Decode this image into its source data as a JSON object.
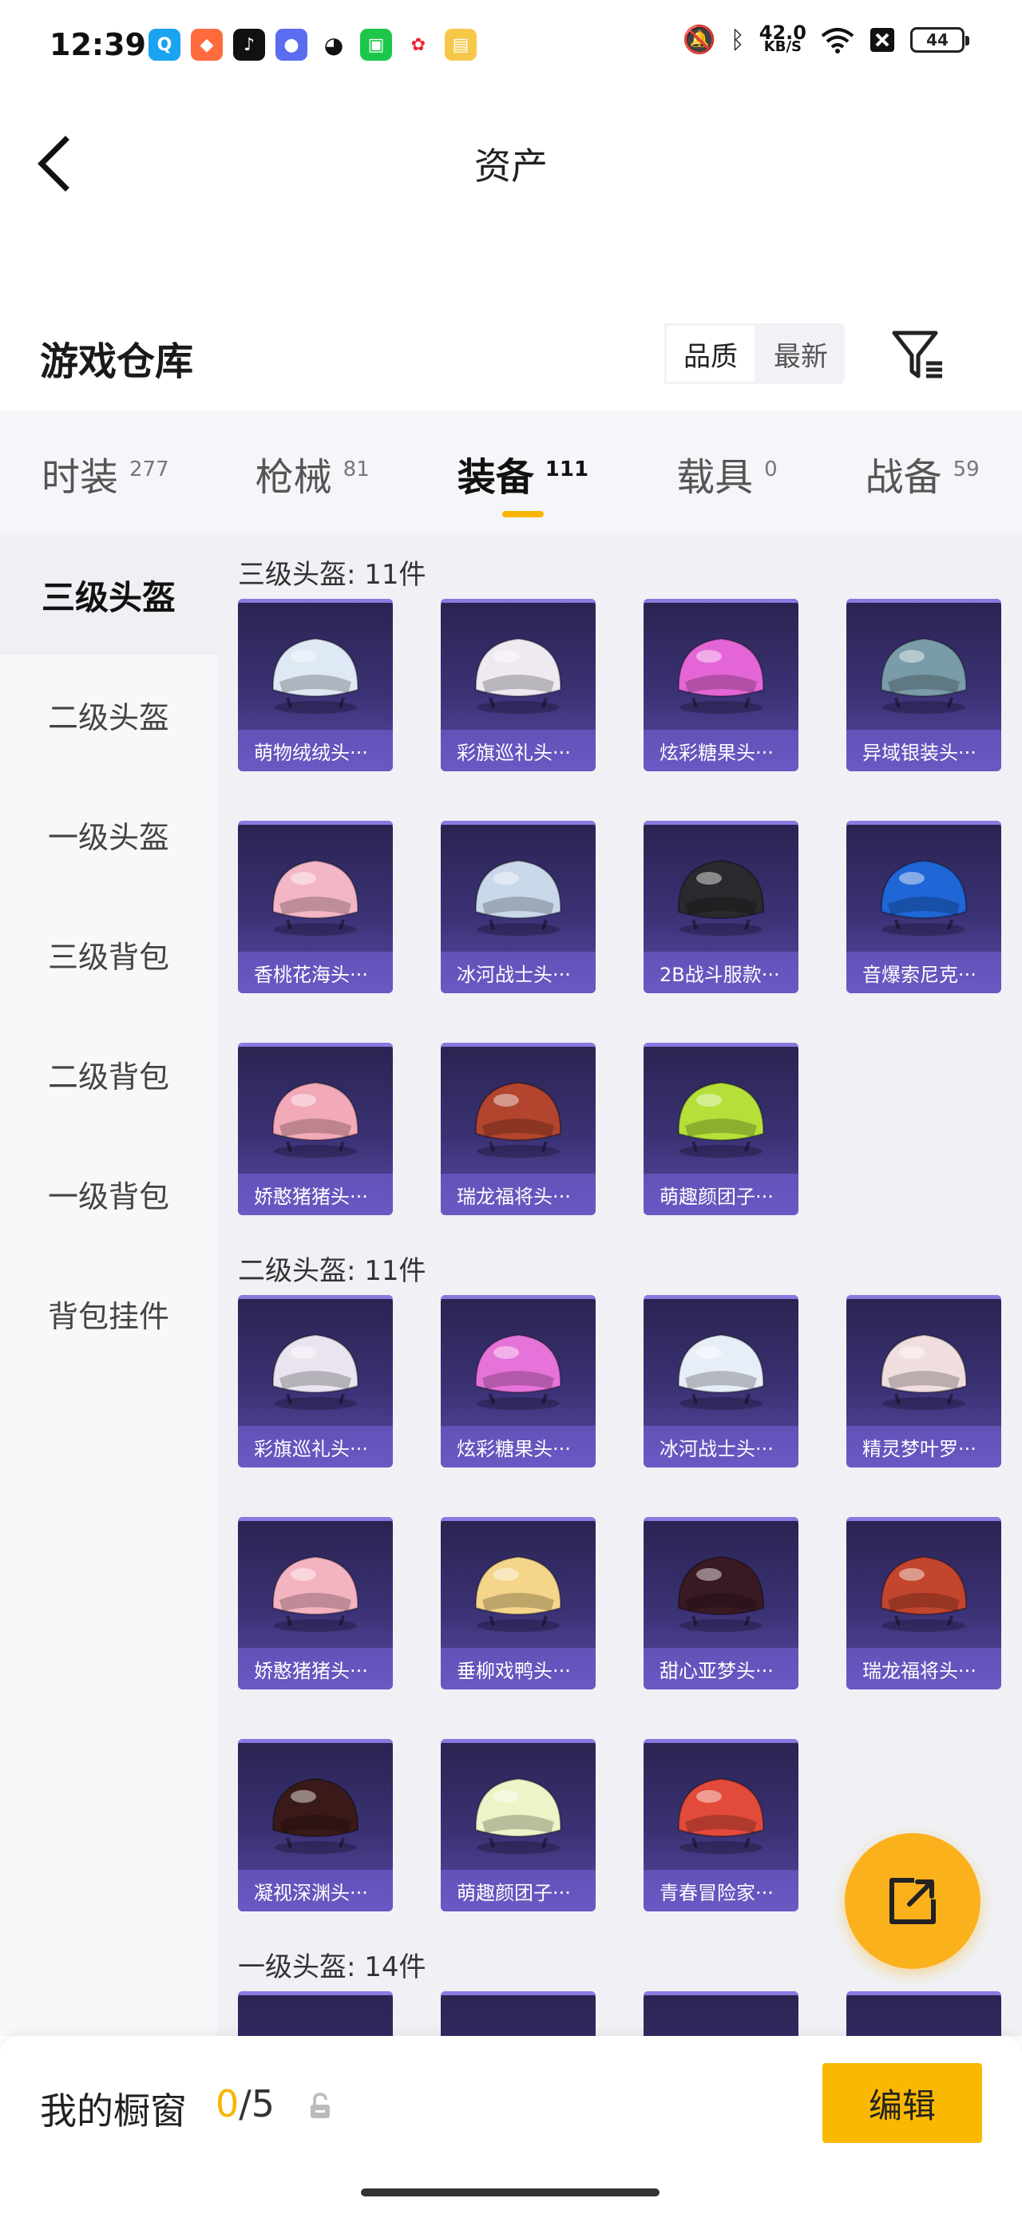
{
  "status_bar": {
    "time": "12:39",
    "speed_value": "42.0",
    "speed_unit": "KB/S",
    "battery": "44",
    "apps": [
      "qq-icon",
      "game-icon",
      "tiktok-icon",
      "app-icon",
      "wechat-icon",
      "app-icon",
      "app-icon",
      "notes-icon"
    ]
  },
  "nav": {
    "title": "资产"
  },
  "section": {
    "title": "游戏仓库",
    "sort_options": [
      "品质",
      "最新"
    ],
    "sort_active": "品质"
  },
  "tabs": [
    {
      "label": "时装",
      "count": "277"
    },
    {
      "label": "枪械",
      "count": "81"
    },
    {
      "label": "装备",
      "count": "111"
    },
    {
      "label": "载具",
      "count": "0"
    },
    {
      "label": "战备",
      "count": "59"
    }
  ],
  "active_tab": "装备",
  "sidebar": [
    {
      "label": "三级头盔"
    },
    {
      "label": "二级头盔"
    },
    {
      "label": "一级头盔"
    },
    {
      "label": "三级背包"
    },
    {
      "label": "二级背包"
    },
    {
      "label": "一级背包"
    },
    {
      "label": "背包挂件"
    }
  ],
  "active_sidebar": "三级头盔",
  "groups": [
    {
      "title": "三级头盔: 11件",
      "items": [
        {
          "name": "萌物绒绒头···",
          "color": "#dfe8f5"
        },
        {
          "name": "彩旗巡礼头···",
          "color": "#efe9f2"
        },
        {
          "name": "炫彩糖果头···",
          "color": "#e466d6"
        },
        {
          "name": "异域银装头···",
          "color": "#7a9ba8"
        },
        {
          "name": "香桃花海头···",
          "color": "#f3b6c6"
        },
        {
          "name": "冰河战士头···",
          "color": "#c9d9ea"
        },
        {
          "name": "2B战斗服款···",
          "color": "#2a2a2e"
        },
        {
          "name": "音爆索尼克···",
          "color": "#1f66d6"
        },
        {
          "name": "娇憨猪猪头···",
          "color": "#f2a9b8"
        },
        {
          "name": "瑞龙福将头···",
          "color": "#b3442e"
        },
        {
          "name": "萌趣颜团子···",
          "color": "#b5e03a"
        }
      ]
    },
    {
      "title": "二级头盔: 11件",
      "items": [
        {
          "name": "彩旗巡礼头···",
          "color": "#e9e4ef"
        },
        {
          "name": "炫彩糖果头···",
          "color": "#e673d9"
        },
        {
          "name": "冰河战士头···",
          "color": "#e7eef8"
        },
        {
          "name": "精灵梦叶罗···",
          "color": "#f0dede"
        },
        {
          "name": "娇憨猪猪头···",
          "color": "#f4b3c0"
        },
        {
          "name": "垂柳戏鸭头···",
          "color": "#f4d58a"
        },
        {
          "name": "甜心亚梦头···",
          "color": "#3a1a22"
        },
        {
          "name": "瑞龙福将头···",
          "color": "#c2452e"
        },
        {
          "name": "凝视深渊头···",
          "color": "#3a1a18"
        },
        {
          "name": "萌趣颜团子···",
          "color": "#eef4c8"
        },
        {
          "name": "青春冒险家···",
          "color": "#e24a3a"
        }
      ]
    },
    {
      "title": "一级头盔: 14件",
      "items": []
    }
  ],
  "fab": {
    "icon": "share-external-icon"
  },
  "bottom": {
    "label": "我的橱窗",
    "current": "0",
    "separator": "/",
    "max": "5",
    "edit_label": "编辑"
  }
}
